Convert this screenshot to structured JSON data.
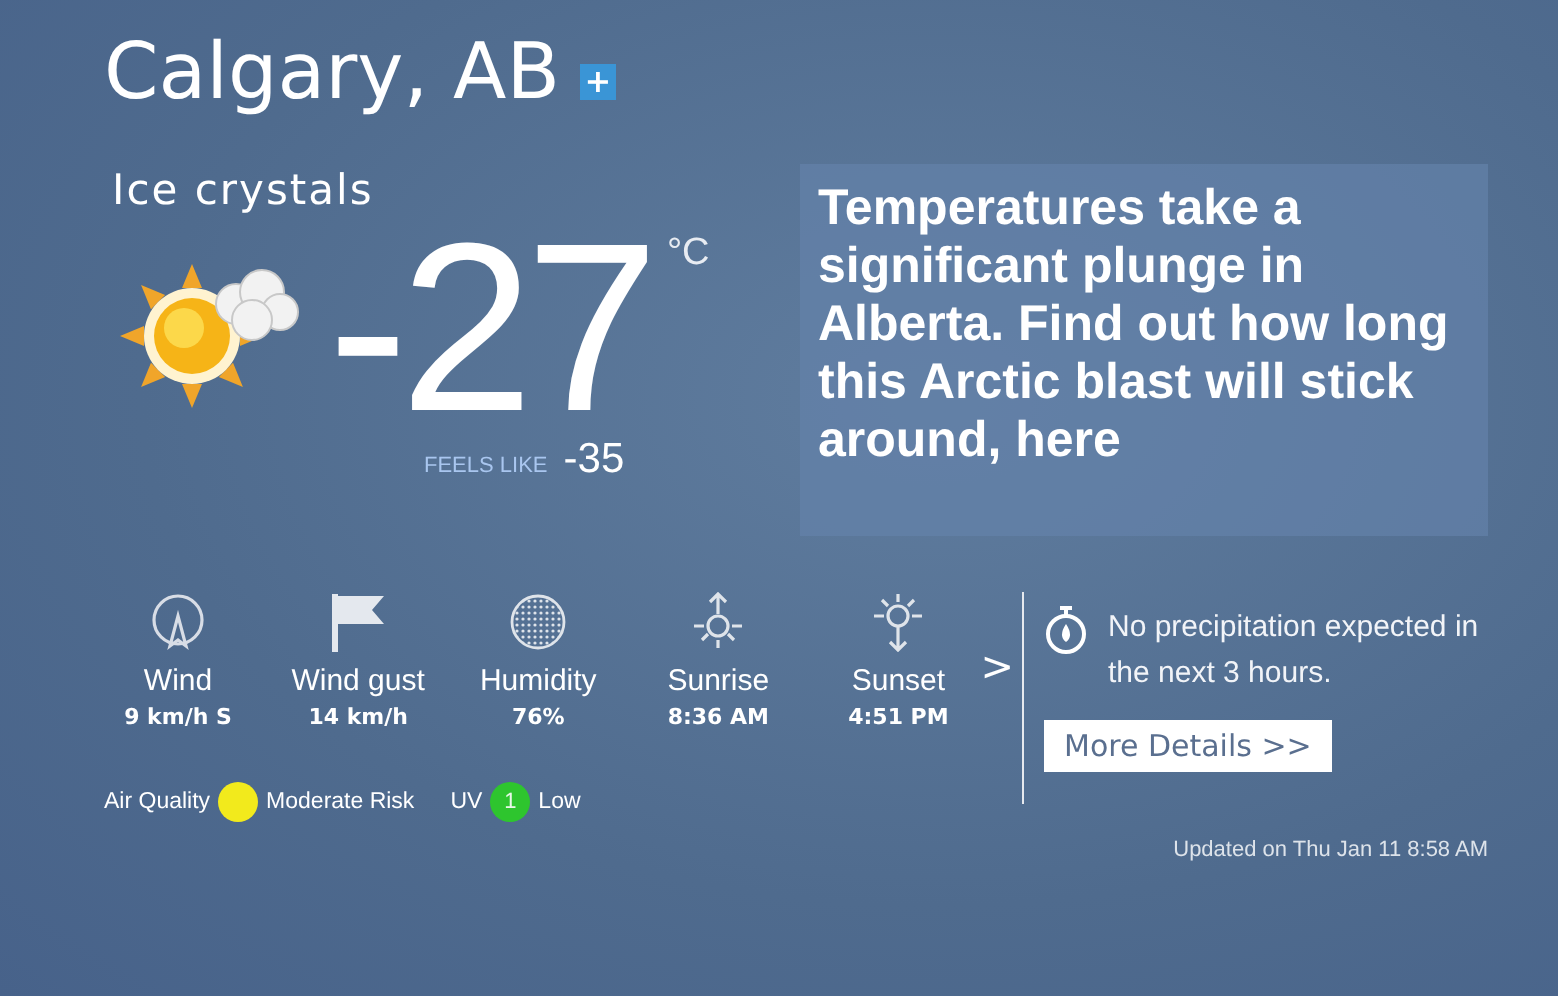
{
  "location": {
    "name": "Calgary, AB",
    "add_button": "+"
  },
  "current": {
    "condition": "Ice crystals",
    "temperature": "-27",
    "unit": "°C",
    "feels_like_label": "FEELS LIKE",
    "feels_like": "-35"
  },
  "promo": {
    "text": "Temperatures take a significant plunge in Alberta. Find out how long this Arctic blast will stick around, here"
  },
  "stats": [
    {
      "kind": "wind",
      "label": "Wind",
      "value": "9 km/h S"
    },
    {
      "kind": "gust",
      "label": "Wind gust",
      "value": "14 km/h"
    },
    {
      "kind": "humidity",
      "label": "Humidity",
      "value": "76%"
    },
    {
      "kind": "sunrise",
      "label": "Sunrise",
      "value": "8:36 AM"
    },
    {
      "kind": "sunset",
      "label": "Sunset",
      "value": "4:51 PM"
    }
  ],
  "next_button": ">",
  "indices": [
    {
      "label": "Air Quality",
      "color": "#f2ea1c",
      "value": "Moderate Risk"
    },
    {
      "label": "UV",
      "badge": "1",
      "color": "#2ec52e",
      "value": "Low"
    }
  ],
  "precipitation": {
    "text": "No precipitation expected in the next 3 hours.",
    "button": "More Details >>"
  },
  "updated": "Updated on Thu Jan 11 8:58 AM"
}
